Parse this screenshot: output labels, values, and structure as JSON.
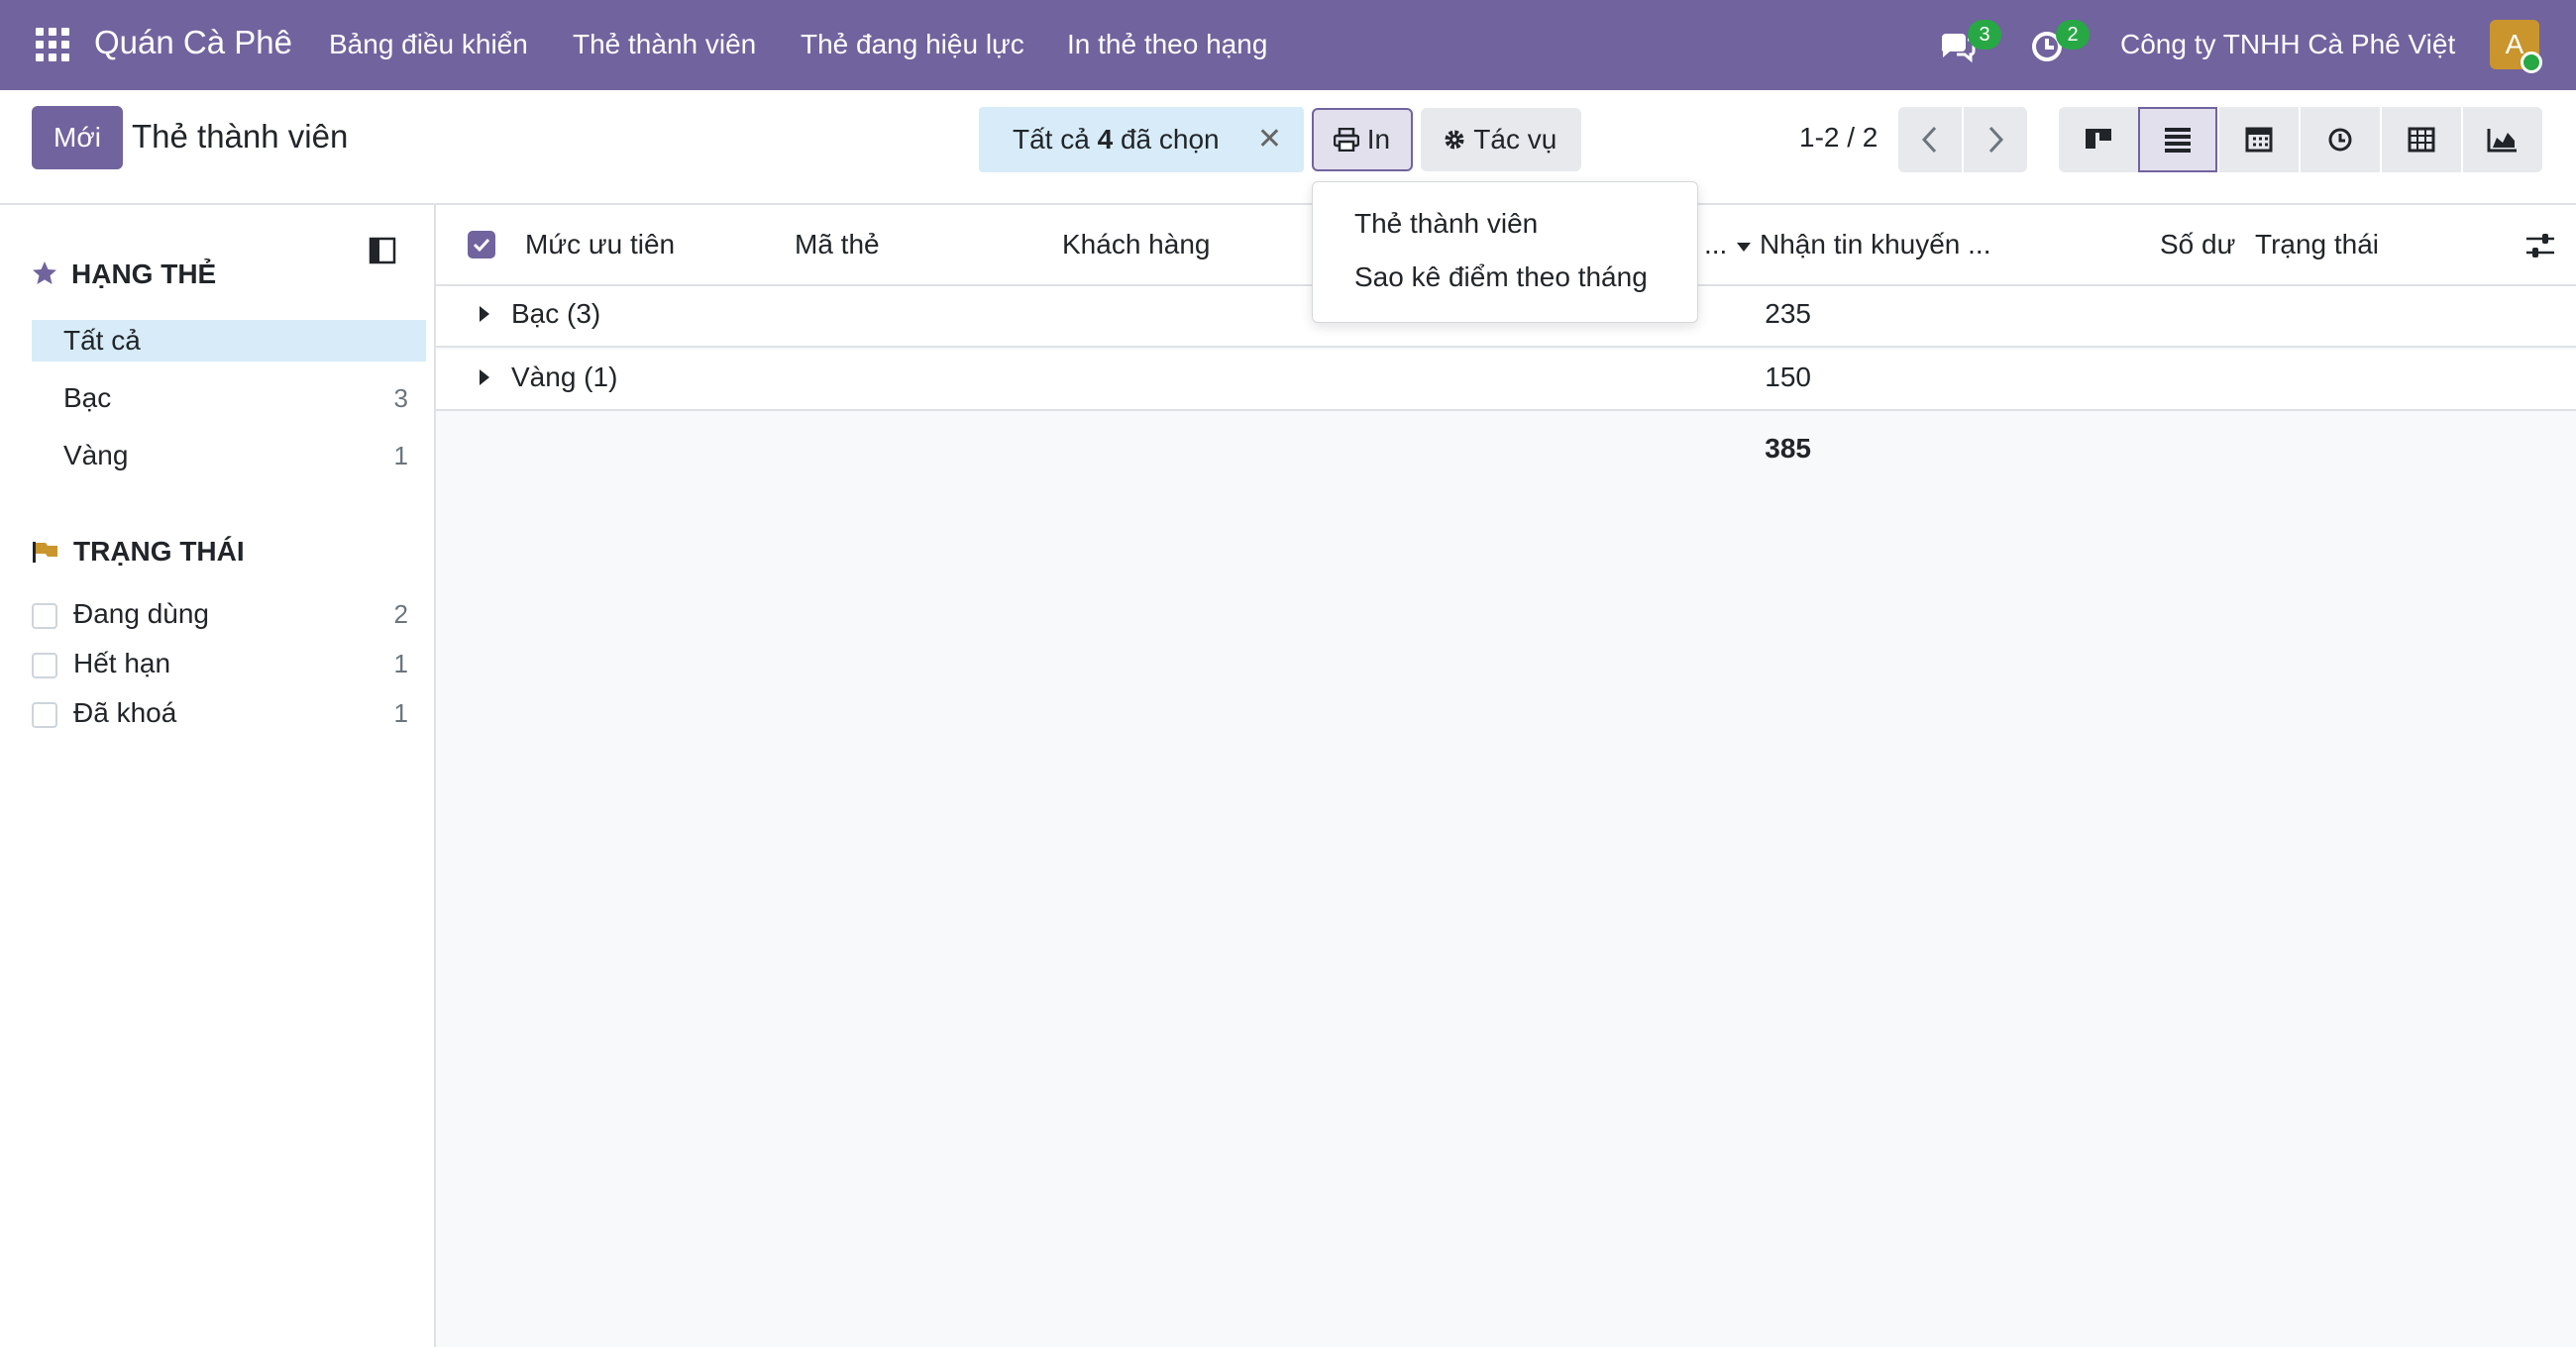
{
  "navbar": {
    "brand": "Quán Cà Phê",
    "menu": [
      "Bảng điều khiển",
      "Thẻ thành viên",
      "Thẻ đang hiệu lực",
      "In thẻ theo hạng"
    ],
    "messages_count": "3",
    "activities_count": "2",
    "company": "Công ty TNHH Cà Phê Việt",
    "avatar_letter": "A"
  },
  "control": {
    "new_label": "Mới",
    "title": "Thẻ thành viên",
    "selection_prefix": "Tất cả ",
    "selection_count": "4",
    "selection_suffix": " đã chọn",
    "print_label": "In",
    "action_label": "Tác vụ",
    "pager": "1-2 / 2"
  },
  "print_menu": {
    "items": [
      "Thẻ thành viên",
      "Sao kê điểm theo tháng"
    ]
  },
  "sidebar": {
    "tier_header": "HẠNG THẺ",
    "tiers": [
      {
        "label": "Tất cả",
        "count": ""
      },
      {
        "label": "Bạc",
        "count": "3"
      },
      {
        "label": "Vàng",
        "count": "1"
      }
    ],
    "status_header": "TRẠNG THÁI",
    "statuses": [
      {
        "label": "Đang dùng",
        "count": "2"
      },
      {
        "label": "Hết hạn",
        "count": "1"
      },
      {
        "label": "Đã khoá",
        "count": "1"
      }
    ]
  },
  "list": {
    "columns": [
      "Mức ưu tiên",
      "Mã thẻ",
      "Khách hàng",
      "...",
      "Nhận tin khuyến ...",
      "Số dư",
      "Trạng thái"
    ],
    "groups": [
      {
        "label": "Bạc (3)",
        "sum": "235"
      },
      {
        "label": "Vàng (1)",
        "sum": "150"
      }
    ],
    "total": "385"
  },
  "colors": {
    "brand": "#71639e",
    "selection": "#d7ecf8",
    "badge": "#28a745"
  }
}
